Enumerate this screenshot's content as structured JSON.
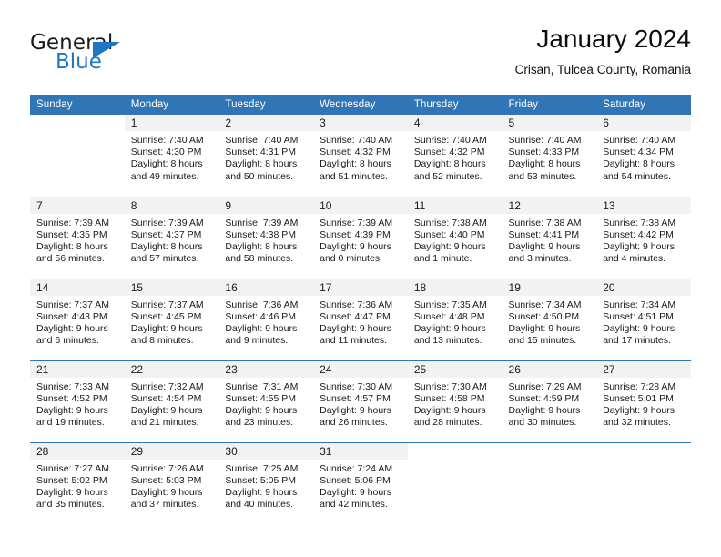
{
  "logo": {
    "text_top": "General",
    "text_bottom": "Blue",
    "accent_color": "#1f77c4"
  },
  "header": {
    "title": "January 2024",
    "subtitle": "Crisan, Tulcea County, Romania"
  },
  "calendar": {
    "header_bg": "#3075b5",
    "daynum_bg": "#f2f2f2",
    "weekday_headers": [
      "Sunday",
      "Monday",
      "Tuesday",
      "Wednesday",
      "Thursday",
      "Friday",
      "Saturday"
    ],
    "weeks": [
      [
        {
          "day": "",
          "sunrise": "",
          "sunset": "",
          "daylight1": "",
          "daylight2": ""
        },
        {
          "day": "1",
          "sunrise": "Sunrise: 7:40 AM",
          "sunset": "Sunset: 4:30 PM",
          "daylight1": "Daylight: 8 hours",
          "daylight2": "and 49 minutes."
        },
        {
          "day": "2",
          "sunrise": "Sunrise: 7:40 AM",
          "sunset": "Sunset: 4:31 PM",
          "daylight1": "Daylight: 8 hours",
          "daylight2": "and 50 minutes."
        },
        {
          "day": "3",
          "sunrise": "Sunrise: 7:40 AM",
          "sunset": "Sunset: 4:32 PM",
          "daylight1": "Daylight: 8 hours",
          "daylight2": "and 51 minutes."
        },
        {
          "day": "4",
          "sunrise": "Sunrise: 7:40 AM",
          "sunset": "Sunset: 4:32 PM",
          "daylight1": "Daylight: 8 hours",
          "daylight2": "and 52 minutes."
        },
        {
          "day": "5",
          "sunrise": "Sunrise: 7:40 AM",
          "sunset": "Sunset: 4:33 PM",
          "daylight1": "Daylight: 8 hours",
          "daylight2": "and 53 minutes."
        },
        {
          "day": "6",
          "sunrise": "Sunrise: 7:40 AM",
          "sunset": "Sunset: 4:34 PM",
          "daylight1": "Daylight: 8 hours",
          "daylight2": "and 54 minutes."
        }
      ],
      [
        {
          "day": "7",
          "sunrise": "Sunrise: 7:39 AM",
          "sunset": "Sunset: 4:35 PM",
          "daylight1": "Daylight: 8 hours",
          "daylight2": "and 56 minutes."
        },
        {
          "day": "8",
          "sunrise": "Sunrise: 7:39 AM",
          "sunset": "Sunset: 4:37 PM",
          "daylight1": "Daylight: 8 hours",
          "daylight2": "and 57 minutes."
        },
        {
          "day": "9",
          "sunrise": "Sunrise: 7:39 AM",
          "sunset": "Sunset: 4:38 PM",
          "daylight1": "Daylight: 8 hours",
          "daylight2": "and 58 minutes."
        },
        {
          "day": "10",
          "sunrise": "Sunrise: 7:39 AM",
          "sunset": "Sunset: 4:39 PM",
          "daylight1": "Daylight: 9 hours",
          "daylight2": "and 0 minutes."
        },
        {
          "day": "11",
          "sunrise": "Sunrise: 7:38 AM",
          "sunset": "Sunset: 4:40 PM",
          "daylight1": "Daylight: 9 hours",
          "daylight2": "and 1 minute."
        },
        {
          "day": "12",
          "sunrise": "Sunrise: 7:38 AM",
          "sunset": "Sunset: 4:41 PM",
          "daylight1": "Daylight: 9 hours",
          "daylight2": "and 3 minutes."
        },
        {
          "day": "13",
          "sunrise": "Sunrise: 7:38 AM",
          "sunset": "Sunset: 4:42 PM",
          "daylight1": "Daylight: 9 hours",
          "daylight2": "and 4 minutes."
        }
      ],
      [
        {
          "day": "14",
          "sunrise": "Sunrise: 7:37 AM",
          "sunset": "Sunset: 4:43 PM",
          "daylight1": "Daylight: 9 hours",
          "daylight2": "and 6 minutes."
        },
        {
          "day": "15",
          "sunrise": "Sunrise: 7:37 AM",
          "sunset": "Sunset: 4:45 PM",
          "daylight1": "Daylight: 9 hours",
          "daylight2": "and 8 minutes."
        },
        {
          "day": "16",
          "sunrise": "Sunrise: 7:36 AM",
          "sunset": "Sunset: 4:46 PM",
          "daylight1": "Daylight: 9 hours",
          "daylight2": "and 9 minutes."
        },
        {
          "day": "17",
          "sunrise": "Sunrise: 7:36 AM",
          "sunset": "Sunset: 4:47 PM",
          "daylight1": "Daylight: 9 hours",
          "daylight2": "and 11 minutes."
        },
        {
          "day": "18",
          "sunrise": "Sunrise: 7:35 AM",
          "sunset": "Sunset: 4:48 PM",
          "daylight1": "Daylight: 9 hours",
          "daylight2": "and 13 minutes."
        },
        {
          "day": "19",
          "sunrise": "Sunrise: 7:34 AM",
          "sunset": "Sunset: 4:50 PM",
          "daylight1": "Daylight: 9 hours",
          "daylight2": "and 15 minutes."
        },
        {
          "day": "20",
          "sunrise": "Sunrise: 7:34 AM",
          "sunset": "Sunset: 4:51 PM",
          "daylight1": "Daylight: 9 hours",
          "daylight2": "and 17 minutes."
        }
      ],
      [
        {
          "day": "21",
          "sunrise": "Sunrise: 7:33 AM",
          "sunset": "Sunset: 4:52 PM",
          "daylight1": "Daylight: 9 hours",
          "daylight2": "and 19 minutes."
        },
        {
          "day": "22",
          "sunrise": "Sunrise: 7:32 AM",
          "sunset": "Sunset: 4:54 PM",
          "daylight1": "Daylight: 9 hours",
          "daylight2": "and 21 minutes."
        },
        {
          "day": "23",
          "sunrise": "Sunrise: 7:31 AM",
          "sunset": "Sunset: 4:55 PM",
          "daylight1": "Daylight: 9 hours",
          "daylight2": "and 23 minutes."
        },
        {
          "day": "24",
          "sunrise": "Sunrise: 7:30 AM",
          "sunset": "Sunset: 4:57 PM",
          "daylight1": "Daylight: 9 hours",
          "daylight2": "and 26 minutes."
        },
        {
          "day": "25",
          "sunrise": "Sunrise: 7:30 AM",
          "sunset": "Sunset: 4:58 PM",
          "daylight1": "Daylight: 9 hours",
          "daylight2": "and 28 minutes."
        },
        {
          "day": "26",
          "sunrise": "Sunrise: 7:29 AM",
          "sunset": "Sunset: 4:59 PM",
          "daylight1": "Daylight: 9 hours",
          "daylight2": "and 30 minutes."
        },
        {
          "day": "27",
          "sunrise": "Sunrise: 7:28 AM",
          "sunset": "Sunset: 5:01 PM",
          "daylight1": "Daylight: 9 hours",
          "daylight2": "and 32 minutes."
        }
      ],
      [
        {
          "day": "28",
          "sunrise": "Sunrise: 7:27 AM",
          "sunset": "Sunset: 5:02 PM",
          "daylight1": "Daylight: 9 hours",
          "daylight2": "and 35 minutes."
        },
        {
          "day": "29",
          "sunrise": "Sunrise: 7:26 AM",
          "sunset": "Sunset: 5:03 PM",
          "daylight1": "Daylight: 9 hours",
          "daylight2": "and 37 minutes."
        },
        {
          "day": "30",
          "sunrise": "Sunrise: 7:25 AM",
          "sunset": "Sunset: 5:05 PM",
          "daylight1": "Daylight: 9 hours",
          "daylight2": "and 40 minutes."
        },
        {
          "day": "31",
          "sunrise": "Sunrise: 7:24 AM",
          "sunset": "Sunset: 5:06 PM",
          "daylight1": "Daylight: 9 hours",
          "daylight2": "and 42 minutes."
        },
        {
          "day": "",
          "sunrise": "",
          "sunset": "",
          "daylight1": "",
          "daylight2": ""
        },
        {
          "day": "",
          "sunrise": "",
          "sunset": "",
          "daylight1": "",
          "daylight2": ""
        },
        {
          "day": "",
          "sunrise": "",
          "sunset": "",
          "daylight1": "",
          "daylight2": ""
        }
      ]
    ]
  }
}
